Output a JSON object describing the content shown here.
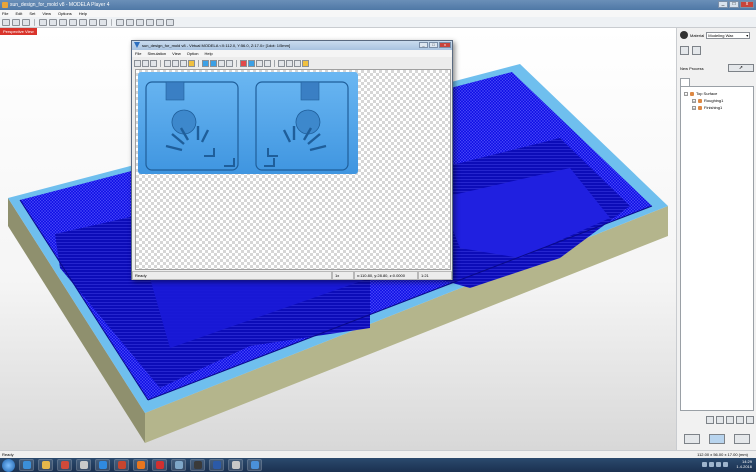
{
  "window": {
    "title": "sun_design_for_mold v8 - MODELA Player 4",
    "controls": [
      "_",
      "□",
      "x"
    ]
  },
  "menu": [
    "File",
    "Edit",
    "Set",
    "View",
    "Options",
    "Help"
  ],
  "toolbar": {
    "icons": [
      "open-icon",
      "save-icon",
      "print-icon",
      "zoom-extents-icon",
      "zoom-in-icon",
      "zoom-out-icon",
      "zoom-window-icon",
      "pan-icon",
      "rotate-icon",
      "fit-icon",
      "view-top-icon",
      "view-front-icon",
      "view-right-icon",
      "view-iso-icon",
      "shade-icon",
      "wire-icon"
    ]
  },
  "viewport": {
    "tag": "Perspective View",
    "colors": {
      "toolpath": "#1010ee",
      "wall": "#b2b38a",
      "rim": "#6fbfee"
    }
  },
  "dialog": {
    "title": "sun_design_for_mold v8 - Virtual MODELA  <X:112.0, Y:56.0, Z:17.0>  [1dot: 1/5mm]",
    "controls": [
      "_",
      "□",
      "x"
    ],
    "menu": [
      "File",
      "Simulation",
      "View",
      "Option",
      "Help"
    ],
    "status": {
      "ready": "Ready",
      "speed": "1x",
      "coords": "x:110.80, y:28.80, z:0.0000",
      "scale": "1:21"
    },
    "colors": {
      "part": "#4aa3ee",
      "part_shadow": "#2a6fb0"
    }
  },
  "right_panel": {
    "material_label": "Material",
    "material_value": "Modeling Wax",
    "new_process_label": "New Process",
    "tree": {
      "root": "Top Surface",
      "children": [
        "Roughing1",
        "Finishing1"
      ]
    }
  },
  "status_bar": {
    "left": "Ready",
    "right": "112.00 x 56.00 x 17.00 (mm)"
  },
  "taskbar": {
    "time": "14:29",
    "date": "1.4.2016",
    "apps": [
      {
        "name": "ie",
        "color": "#3b8fd9"
      },
      {
        "name": "explorer",
        "color": "#e6b84a"
      },
      {
        "name": "app3",
        "color": "#d04a3a"
      },
      {
        "name": "app4",
        "color": "#c9c9c9"
      },
      {
        "name": "app5",
        "color": "#2f8ae0"
      },
      {
        "name": "app6",
        "color": "#c6452f"
      },
      {
        "name": "firefox",
        "color": "#e8761e"
      },
      {
        "name": "app8",
        "color": "#d03030"
      },
      {
        "name": "app9",
        "color": "#7fa7c8"
      },
      {
        "name": "app10",
        "color": "#3a3a3a"
      },
      {
        "name": "word",
        "color": "#2b5aa8"
      },
      {
        "name": "app12",
        "color": "#c8c8c8"
      },
      {
        "name": "modela",
        "color": "#4a90d9"
      }
    ]
  }
}
